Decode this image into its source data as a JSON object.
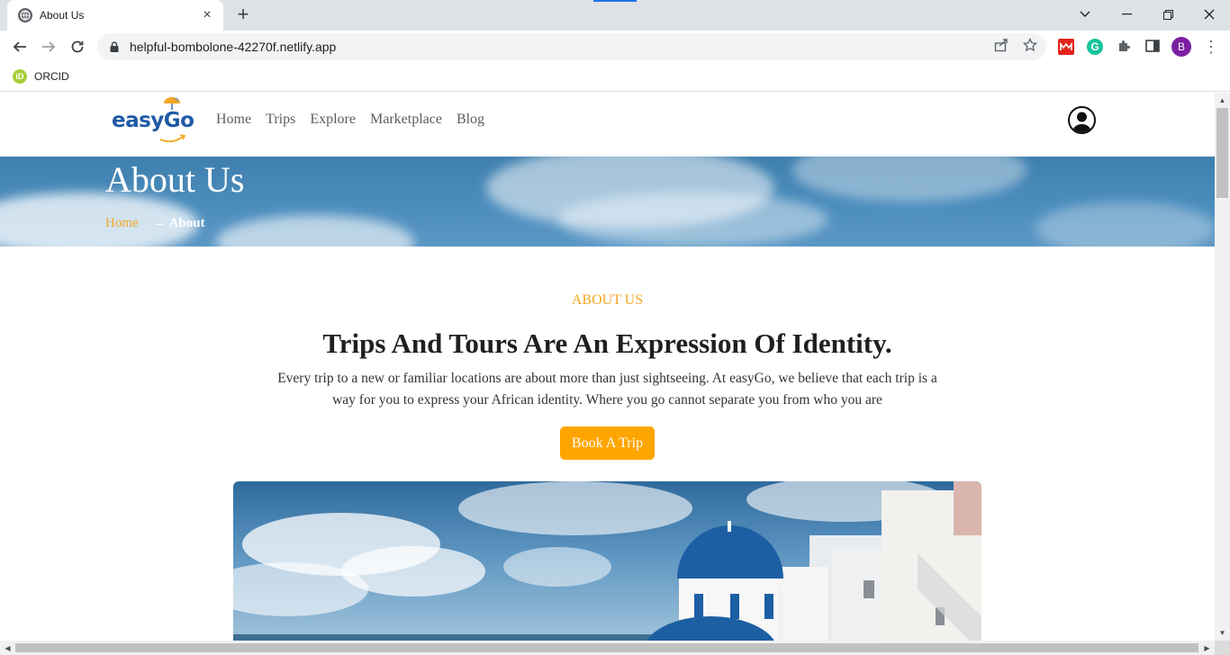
{
  "browser": {
    "tab_title": "About Us",
    "url": "helpful-bombolone-42270f.netlify.app",
    "profile_initial": "B",
    "bookmark": "ORCID"
  },
  "site": {
    "logo_text": "easyGo",
    "nav": [
      "Home",
      "Trips",
      "Explore",
      "Marketplace",
      "Blog"
    ]
  },
  "hero": {
    "title": "About Us",
    "breadcrumb_home": "Home",
    "breadcrumb_current": "→ About"
  },
  "about": {
    "eyebrow": "ABOUT US",
    "heading": "Trips And Tours Are An Expression Of Identity.",
    "body": "Every trip to a new or familiar locations are about more than just sightseeing. At easyGo, we believe that each trip is a way for you to express your African identity. Where you go cannot separate you from who you are",
    "cta": "Book A Trip"
  },
  "colors": {
    "accent": "#ffa500",
    "brand_blue": "#1f5aa6",
    "hero_blue": "#4c8dbd"
  }
}
